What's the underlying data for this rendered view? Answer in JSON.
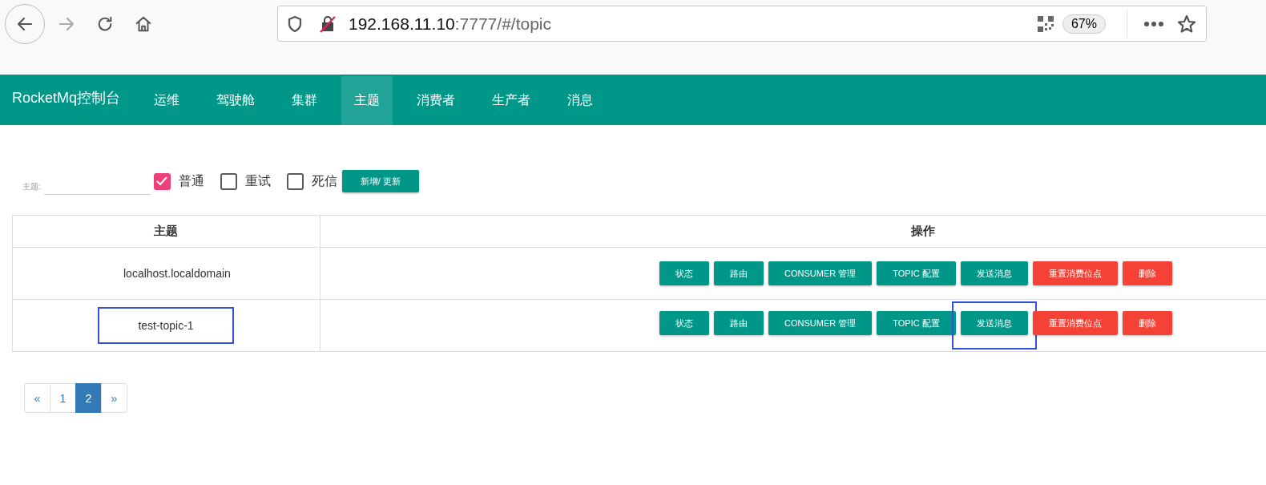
{
  "browser": {
    "url_host": "192.168.11.10",
    "url_rest": ":7777/#/topic",
    "zoom": "67%"
  },
  "navbar": {
    "brand": "RocketMq控制台",
    "items": [
      {
        "label": "运维",
        "selected": false
      },
      {
        "label": "驾驶舱",
        "selected": false
      },
      {
        "label": "集群",
        "selected": false
      },
      {
        "label": "主题",
        "selected": true
      },
      {
        "label": "消费者",
        "selected": false
      },
      {
        "label": "生产者",
        "selected": false
      },
      {
        "label": "消息",
        "selected": false
      }
    ]
  },
  "filter": {
    "field_label": "主题:",
    "checkboxes": [
      {
        "label": "普通",
        "checked": true
      },
      {
        "label": "重试",
        "checked": false
      },
      {
        "label": "死信",
        "checked": false
      }
    ],
    "submit": "新增/ 更新"
  },
  "table": {
    "columns": [
      "主题",
      "操作"
    ],
    "rows": [
      {
        "topic": "localhost.localdomain",
        "highlighted": false,
        "actions": [
          {
            "label": "状态",
            "kind": "primary",
            "highlighted": false
          },
          {
            "label": "路由",
            "kind": "primary",
            "highlighted": false
          },
          {
            "label": "CONSUMER 管理",
            "kind": "primary",
            "highlighted": false
          },
          {
            "label": "TOPIC 配置",
            "kind": "primary",
            "highlighted": false
          },
          {
            "label": "发送消息",
            "kind": "primary",
            "highlighted": false
          },
          {
            "label": "重置消费位点",
            "kind": "danger",
            "highlighted": false
          },
          {
            "label": "删除",
            "kind": "danger",
            "highlighted": false
          }
        ]
      },
      {
        "topic": "test-topic-1",
        "highlighted": true,
        "actions": [
          {
            "label": "状态",
            "kind": "primary",
            "highlighted": false
          },
          {
            "label": "路由",
            "kind": "primary",
            "highlighted": false
          },
          {
            "label": "CONSUMER 管理",
            "kind": "primary",
            "highlighted": false
          },
          {
            "label": "TOPIC 配置",
            "kind": "primary",
            "highlighted": false
          },
          {
            "label": "发送消息",
            "kind": "primary",
            "highlighted": true
          },
          {
            "label": "重置消费位点",
            "kind": "danger",
            "highlighted": false
          },
          {
            "label": "删除",
            "kind": "danger",
            "highlighted": false
          }
        ]
      }
    ]
  },
  "pagination": {
    "prev": "«",
    "pages": [
      {
        "label": "1",
        "selected": false
      },
      {
        "label": "2",
        "selected": true
      }
    ],
    "next": "»"
  }
}
